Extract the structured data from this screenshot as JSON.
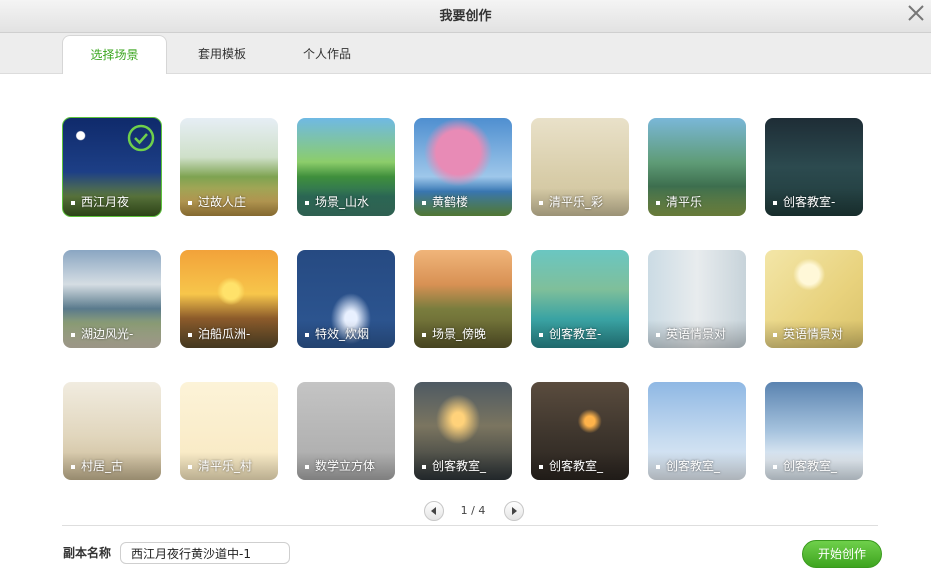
{
  "window": {
    "title": "我要创作"
  },
  "tabs": [
    {
      "label": "选择场景"
    },
    {
      "label": "套用模板"
    },
    {
      "label": "个人作品"
    }
  ],
  "scenes": [
    {
      "label": "西江月夜",
      "selected": true
    },
    {
      "label": "过故人庄"
    },
    {
      "label": "场景_山水"
    },
    {
      "label": "黄鹤楼"
    },
    {
      "label": "清平乐_彩"
    },
    {
      "label": "清平乐"
    },
    {
      "label": "创客教室-"
    },
    {
      "label": "湖边风光-"
    },
    {
      "label": "泊船瓜洲-"
    },
    {
      "label": "特效_炊烟"
    },
    {
      "label": "场景_傍晚"
    },
    {
      "label": "创客教室-"
    },
    {
      "label": "英语情景对"
    },
    {
      "label": "英语情景对"
    },
    {
      "label": "村居_古"
    },
    {
      "label": "清平乐_村"
    },
    {
      "label": "数学立方体"
    },
    {
      "label": "创客教室_"
    },
    {
      "label": "创客教室_"
    },
    {
      "label": "创客教室_"
    },
    {
      "label": "创客教室_"
    }
  ],
  "pager": {
    "text": "1 / 4"
  },
  "footer": {
    "name_label": "副本名称",
    "name_value": "西江月夜行黄沙道中-1",
    "start_label": "开始创作"
  },
  "colors": {
    "accent": "#3aa61e",
    "button_green": "#4cb52a"
  }
}
